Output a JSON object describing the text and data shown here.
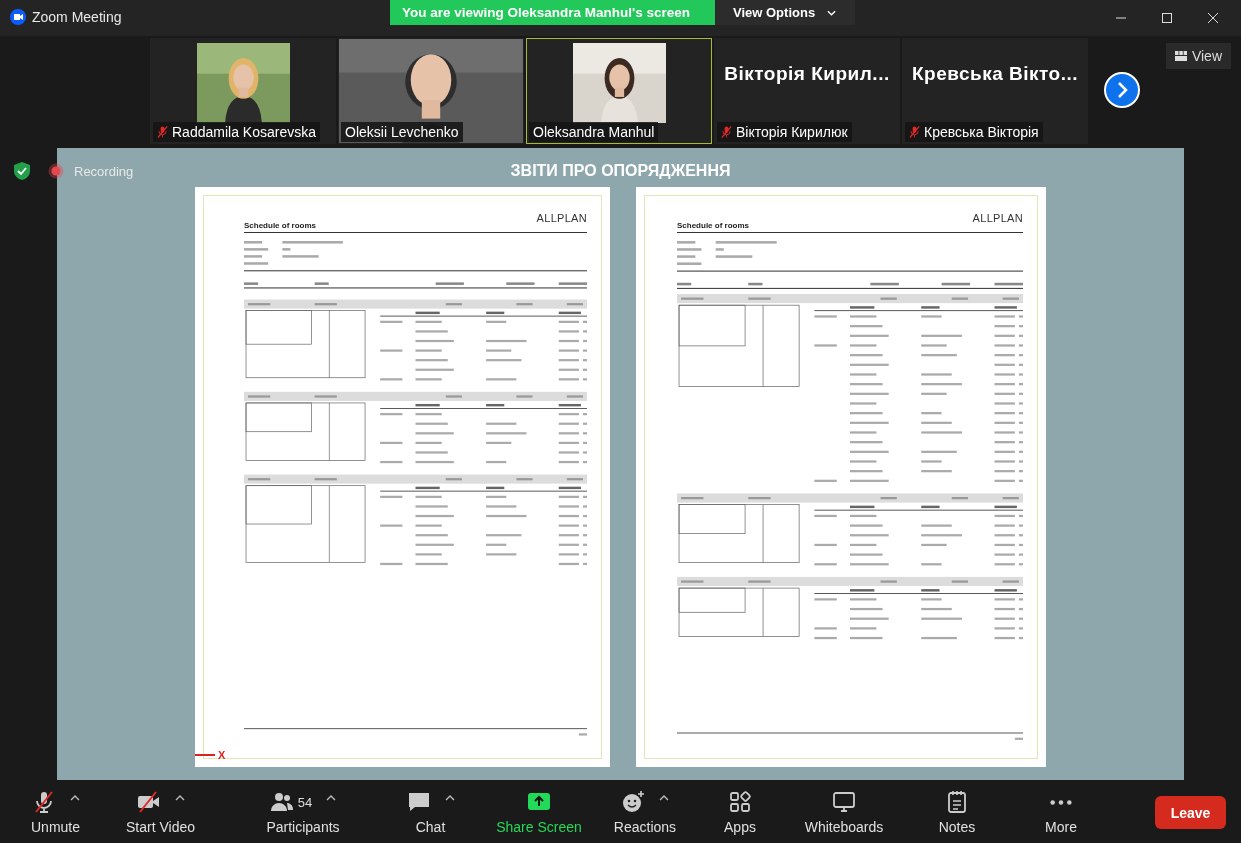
{
  "window": {
    "title": "Zoom Meeting"
  },
  "banner": {
    "text": "You are viewing Oleksandra Manhul's screen",
    "options": "View Options"
  },
  "gallery": {
    "view_button": "View",
    "participants": [
      {
        "name": "Raddamila Kosarevska",
        "kind": "video",
        "muted": true,
        "speaking": false
      },
      {
        "name": "Oleksii Levchenko",
        "kind": "video",
        "muted": false,
        "speaking": false
      },
      {
        "name": "Oleksandra Manhul",
        "kind": "video",
        "muted": false,
        "speaking": true
      },
      {
        "name": "Вікторія Кирилюк",
        "kind": "name",
        "display_name": "Вікторія Кирил...",
        "muted": true,
        "speaking": false
      },
      {
        "name": "Кревська Вікторія",
        "kind": "name",
        "display_name": "Кревська Вікто...",
        "muted": true,
        "speaking": false
      }
    ]
  },
  "recording": {
    "label": "Recording"
  },
  "share": {
    "title": "ЗВІТИ ПРО ОПОРЯДЖЕННЯ",
    "pages": [
      {
        "logo": "ALLPLAN",
        "title": "Schedule of rooms",
        "axis_marker": "X"
      },
      {
        "logo": "ALLPLAN",
        "title": "Schedule of rooms"
      }
    ]
  },
  "toolbar": {
    "leave": "Leave",
    "items": [
      {
        "label": "Unmute",
        "kind": "mic",
        "off": true,
        "caret": true
      },
      {
        "label": "Start Video",
        "kind": "video",
        "off": true,
        "caret": true
      },
      {
        "label": "Participants",
        "kind": "participants",
        "count": "54",
        "caret": true
      },
      {
        "label": "Chat",
        "kind": "chat",
        "caret": true
      },
      {
        "label": "Share Screen",
        "kind": "share",
        "caret": false
      },
      {
        "label": "Reactions",
        "kind": "reactions",
        "caret": true
      },
      {
        "label": "Apps",
        "kind": "apps",
        "caret": false
      },
      {
        "label": "Whiteboards",
        "kind": "whiteboards",
        "caret": false
      },
      {
        "label": "Notes",
        "kind": "notes",
        "caret": false
      },
      {
        "label": "More",
        "kind": "more",
        "caret": false
      }
    ]
  }
}
